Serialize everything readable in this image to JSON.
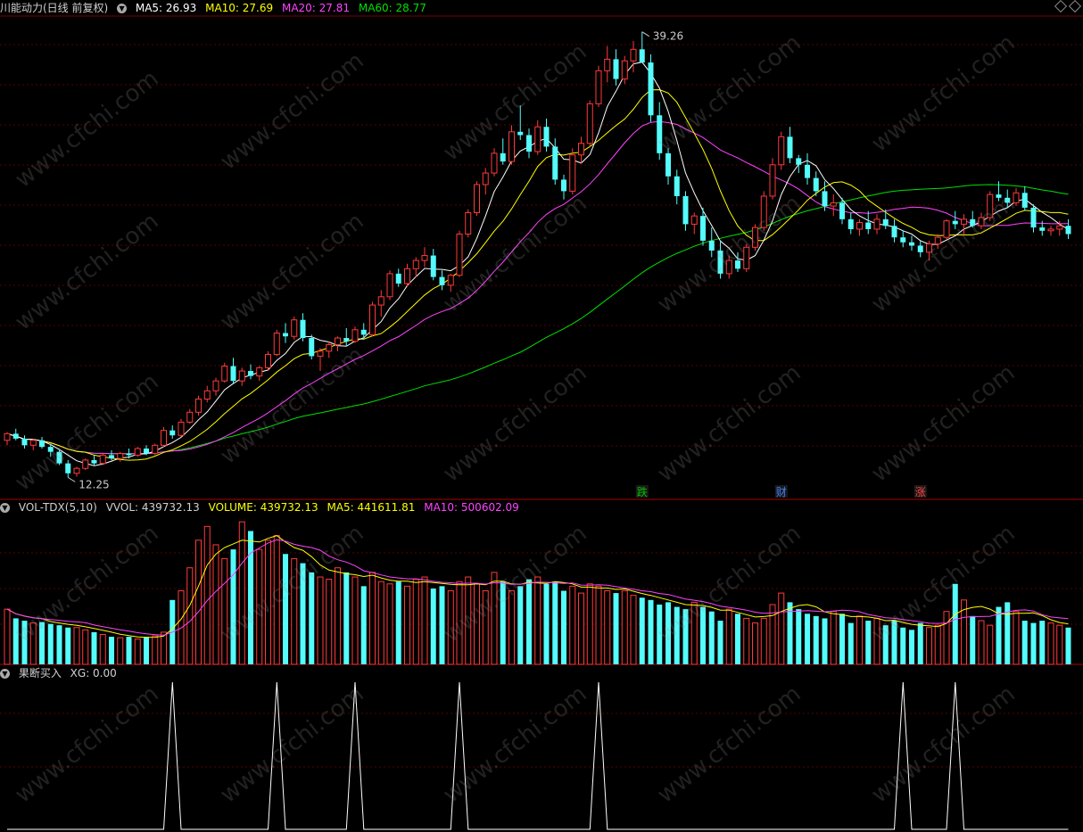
{
  "header": {
    "title": "川能动力(日线 前复权)",
    "ma5": "MA5: 26.93",
    "ma10": "MA10: 27.69",
    "ma20": "MA20: 27.81",
    "ma60": "MA60: 28.77"
  },
  "volume_header": {
    "name": "VOL-TDX(5,10)",
    "vvol": "VVOL: 439732.13",
    "volume": "VOLUME: 439732.13",
    "ma5": "MA5: 441611.81",
    "ma10": "MA10: 500602.09"
  },
  "signal_header": {
    "name": "果断买入",
    "xg": "XG: 0.00"
  },
  "annotations": {
    "high_label": "39.26",
    "low_label": "12.25",
    "marker_die": "跌",
    "marker_cai": "财",
    "marker_zhang": "涨"
  },
  "watermark": "www.cfchi.com",
  "colors": {
    "up": "#ff3a3a",
    "down": "#54fcfc",
    "ma5": "#ffffff",
    "ma10": "#ffff00",
    "ma20": "#ff44ff",
    "ma60": "#00e000",
    "grid": "#5a0000",
    "signal": "#ffffff"
  },
  "chart_data": [
    {
      "type": "candlestick",
      "price_range": [
        12.25,
        39.26
      ],
      "ohlc": [
        [
          14.5,
          15.0,
          14.2,
          14.9
        ],
        [
          14.9,
          15.2,
          14.5,
          14.6
        ],
        [
          14.6,
          14.8,
          14.0,
          14.2
        ],
        [
          14.2,
          14.6,
          13.9,
          14.5
        ],
        [
          14.5,
          14.7,
          14.0,
          14.1
        ],
        [
          14.1,
          14.3,
          13.5,
          13.8
        ],
        [
          13.8,
          13.9,
          13.0,
          13.1
        ],
        [
          13.1,
          13.3,
          12.25,
          12.5
        ],
        [
          12.5,
          12.9,
          12.3,
          12.8
        ],
        [
          12.8,
          13.4,
          12.7,
          13.3
        ],
        [
          13.3,
          13.6,
          13.0,
          13.1
        ],
        [
          13.1,
          13.7,
          13.0,
          13.6
        ],
        [
          13.6,
          13.9,
          13.3,
          13.4
        ],
        [
          13.4,
          13.8,
          13.2,
          13.7
        ],
        [
          13.7,
          14.0,
          13.4,
          13.6
        ],
        [
          13.6,
          14.1,
          13.5,
          14.0
        ],
        [
          14.0,
          14.2,
          13.6,
          13.7
        ],
        [
          13.7,
          14.3,
          13.6,
          14.2
        ],
        [
          14.2,
          15.3,
          14.1,
          15.1
        ],
        [
          15.1,
          15.4,
          14.6,
          14.8
        ],
        [
          14.8,
          15.8,
          14.7,
          15.6
        ],
        [
          15.6,
          16.4,
          15.5,
          16.2
        ],
        [
          16.2,
          17.2,
          16.0,
          17.0
        ],
        [
          17.0,
          17.8,
          16.8,
          17.5
        ],
        [
          17.5,
          18.3,
          17.2,
          18.1
        ],
        [
          18.1,
          19.2,
          18.0,
          19.0
        ],
        [
          19.0,
          19.5,
          17.9,
          18.1
        ],
        [
          18.1,
          18.9,
          17.8,
          18.7
        ],
        [
          18.7,
          19.1,
          18.2,
          18.4
        ],
        [
          18.4,
          19.0,
          18.1,
          18.9
        ],
        [
          18.9,
          19.9,
          18.7,
          19.7
        ],
        [
          19.7,
          21.2,
          19.6,
          21.0
        ],
        [
          21.0,
          21.6,
          20.4,
          20.8
        ],
        [
          20.8,
          22.0,
          20.6,
          21.8
        ],
        [
          21.8,
          22.2,
          20.5,
          20.7
        ],
        [
          20.7,
          20.9,
          19.4,
          19.6
        ],
        [
          19.6,
          20.1,
          18.7,
          19.9
        ],
        [
          19.9,
          20.5,
          19.5,
          20.3
        ],
        [
          20.3,
          20.8,
          19.9,
          20.7
        ],
        [
          20.7,
          21.3,
          20.2,
          20.5
        ],
        [
          20.5,
          21.4,
          20.4,
          21.2
        ],
        [
          21.2,
          21.6,
          20.6,
          20.9
        ],
        [
          20.9,
          22.9,
          20.8,
          22.7
        ],
        [
          22.7,
          23.6,
          22.0,
          23.2
        ],
        [
          23.2,
          24.8,
          23.0,
          24.6
        ],
        [
          24.6,
          24.9,
          23.8,
          24.0
        ],
        [
          24.0,
          25.2,
          23.8,
          24.9
        ],
        [
          24.9,
          25.6,
          24.4,
          25.4
        ],
        [
          25.4,
          26.2,
          25.0,
          25.7
        ],
        [
          25.7,
          26.1,
          24.2,
          24.4
        ],
        [
          24.4,
          24.8,
          23.6,
          23.9
        ],
        [
          23.9,
          24.6,
          23.5,
          24.5
        ],
        [
          24.5,
          27.2,
          24.4,
          27.0
        ],
        [
          27.0,
          28.5,
          26.8,
          28.3
        ],
        [
          28.3,
          30.2,
          28.1,
          30.0
        ],
        [
          30.0,
          31.0,
          29.4,
          30.7
        ],
        [
          30.7,
          32.2,
          30.5,
          31.9
        ],
        [
          31.9,
          32.8,
          31.2,
          31.4
        ],
        [
          31.4,
          33.6,
          31.2,
          33.2
        ],
        [
          33.2,
          34.8,
          32.7,
          33.0
        ],
        [
          33.0,
          33.4,
          31.6,
          32.0
        ],
        [
          32.0,
          33.9,
          31.8,
          33.5
        ],
        [
          33.5,
          34.0,
          32.0,
          32.3
        ],
        [
          32.3,
          32.8,
          30.0,
          30.3
        ],
        [
          30.3,
          30.6,
          29.1,
          29.6
        ],
        [
          29.6,
          32.2,
          29.4,
          31.8
        ],
        [
          31.8,
          32.9,
          31.3,
          32.5
        ],
        [
          32.5,
          35.1,
          32.3,
          34.9
        ],
        [
          34.9,
          37.2,
          34.7,
          36.9
        ],
        [
          36.9,
          38.4,
          36.2,
          37.6
        ],
        [
          37.6,
          38.2,
          36.0,
          36.4
        ],
        [
          36.4,
          37.8,
          36.1,
          37.5
        ],
        [
          37.5,
          38.7,
          36.8,
          38.2
        ],
        [
          38.2,
          39.26,
          37.5,
          37.4
        ],
        [
          37.4,
          37.9,
          33.8,
          34.2
        ],
        [
          34.2,
          35.0,
          31.5,
          31.9
        ],
        [
          31.9,
          32.2,
          30.0,
          30.5
        ],
        [
          30.5,
          30.9,
          28.8,
          29.3
        ],
        [
          29.3,
          29.6,
          27.2,
          27.6
        ],
        [
          27.6,
          28.3,
          27.0,
          28.1
        ],
        [
          28.1,
          28.6,
          26.3,
          26.6
        ],
        [
          26.6,
          27.4,
          25.6,
          26.0
        ],
        [
          26.0,
          26.6,
          24.3,
          24.6
        ],
        [
          24.6,
          25.7,
          24.3,
          25.4
        ],
        [
          25.4,
          25.9,
          24.7,
          24.9
        ],
        [
          24.9,
          26.4,
          24.7,
          26.2
        ],
        [
          26.2,
          27.6,
          26.0,
          27.4
        ],
        [
          27.4,
          29.6,
          27.2,
          29.3
        ],
        [
          29.3,
          31.6,
          29.1,
          31.2
        ],
        [
          31.2,
          33.2,
          30.9,
          32.9
        ],
        [
          32.9,
          33.5,
          31.3,
          31.6
        ],
        [
          31.6,
          31.8,
          30.7,
          31.2
        ],
        [
          31.2,
          31.9,
          30.0,
          30.4
        ],
        [
          30.4,
          30.8,
          29.3,
          29.6
        ],
        [
          29.6,
          30.2,
          28.4,
          28.7
        ],
        [
          28.7,
          29.4,
          28.1,
          28.9
        ],
        [
          28.9,
          29.2,
          27.6,
          27.9
        ],
        [
          27.9,
          28.3,
          27.0,
          27.3
        ],
        [
          27.3,
          27.9,
          26.9,
          27.7
        ],
        [
          27.7,
          28.4,
          27.0,
          27.3
        ],
        [
          27.3,
          28.2,
          27.0,
          27.9
        ],
        [
          27.9,
          28.5,
          27.3,
          27.5
        ],
        [
          27.5,
          27.9,
          26.5,
          26.8
        ],
        [
          26.8,
          27.2,
          26.2,
          26.5
        ],
        [
          26.5,
          26.9,
          26.0,
          26.3
        ],
        [
          26.3,
          26.6,
          25.6,
          25.9
        ],
        [
          25.9,
          26.6,
          25.4,
          26.4
        ],
        [
          26.4,
          27.0,
          26.1,
          26.8
        ],
        [
          26.8,
          27.9,
          26.7,
          27.8
        ],
        [
          27.8,
          28.4,
          27.3,
          27.6
        ],
        [
          27.6,
          28.2,
          27.0,
          27.9
        ],
        [
          27.9,
          28.4,
          27.4,
          27.5
        ],
        [
          27.5,
          28.3,
          27.3,
          28.0
        ],
        [
          28.0,
          29.6,
          27.8,
          29.4
        ],
        [
          29.4,
          30.2,
          29.0,
          29.2
        ],
        [
          29.2,
          29.7,
          28.6,
          28.9
        ],
        [
          28.9,
          29.8,
          28.7,
          29.5
        ],
        [
          29.5,
          29.9,
          28.4,
          28.6
        ],
        [
          28.6,
          28.8,
          27.1,
          27.4
        ],
        [
          27.4,
          27.8,
          26.9,
          27.2
        ],
        [
          27.2,
          27.5,
          26.9,
          27.3
        ],
        [
          27.3,
          27.8,
          26.9,
          27.5
        ],
        [
          27.5,
          27.9,
          26.7,
          27.0
        ]
      ],
      "ma_lines": [
        "MA5",
        "MA10",
        "MA20",
        "MA60"
      ]
    },
    {
      "type": "bar",
      "name": "VOL-TDX(5,10)",
      "values": [
        1.2,
        1.0,
        0.95,
        0.9,
        0.92,
        0.88,
        0.85,
        0.8,
        0.8,
        0.75,
        0.7,
        0.65,
        0.6,
        0.58,
        0.6,
        0.55,
        0.6,
        0.62,
        0.7,
        1.4,
        1.6,
        2.1,
        2.7,
        3.0,
        2.6,
        2.3,
        2.5,
        3.1,
        2.9,
        2.5,
        2.7,
        2.8,
        2.4,
        2.3,
        2.2,
        2.0,
        1.9,
        1.85,
        2.1,
        2.0,
        1.9,
        1.7,
        2.0,
        1.8,
        1.75,
        1.8,
        1.7,
        1.85,
        1.9,
        1.65,
        1.7,
        1.6,
        1.8,
        1.9,
        1.75,
        1.6,
        2.0,
        1.8,
        1.6,
        1.7,
        1.85,
        1.9,
        1.75,
        1.8,
        1.6,
        1.7,
        1.55,
        1.75,
        1.7,
        1.6,
        1.55,
        1.6,
        1.5,
        1.45,
        1.4,
        1.3,
        1.35,
        1.25,
        1.2,
        1.35,
        1.25,
        1.15,
        0.95,
        1.2,
        1.1,
        1.0,
        0.9,
        1.0,
        1.3,
        1.55,
        1.35,
        1.2,
        1.1,
        1.05,
        1.0,
        1.15,
        1.1,
        0.9,
        1.05,
        0.95,
        1.0,
        0.85,
        0.95,
        0.8,
        0.75,
        0.9,
        0.8,
        0.85,
        1.15,
        1.75,
        1.4,
        1.05,
        0.95,
        0.85,
        1.25,
        1.35,
        1.15,
        0.95,
        0.9,
        0.95,
        0.9,
        0.85,
        0.8
      ]
    },
    {
      "type": "line",
      "name": "果断买入 XG",
      "signal_indices": [
        19,
        31,
        40,
        52,
        68,
        103,
        109
      ]
    }
  ]
}
